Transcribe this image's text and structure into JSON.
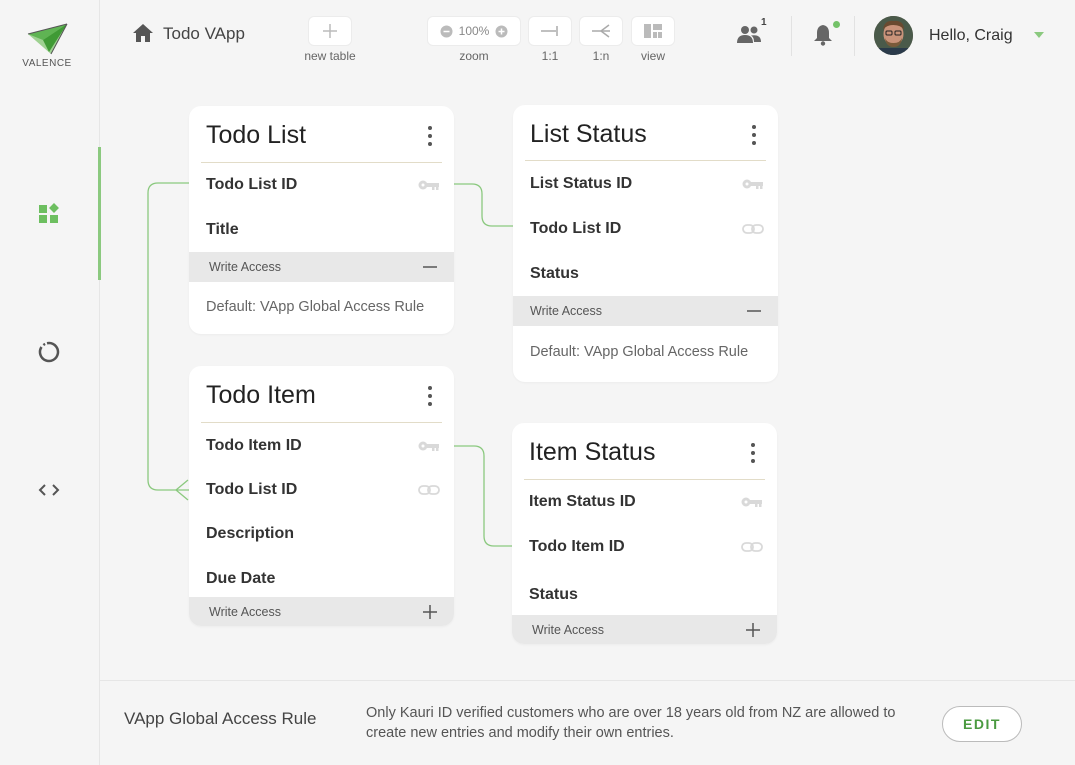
{
  "brand": {
    "name": "VALENCE",
    "accent": "#8bc97f"
  },
  "header": {
    "app_title": "Todo VApp",
    "tools": {
      "new_table": "new table",
      "zoom_label": "zoom",
      "zoom_value": "100%",
      "one_to_one": "1:1",
      "one_to_many": "1:n",
      "view": "view"
    },
    "users_count": "1",
    "greeting": "Hello, Craig"
  },
  "sidebar": {
    "items": [
      {
        "icon": "dashboard-icon",
        "active": true
      },
      {
        "icon": "sync-icon"
      },
      {
        "icon": "code-icon"
      }
    ]
  },
  "tables": {
    "todo_list": {
      "title": "Todo List",
      "fields": [
        "Todo List ID",
        "Title"
      ],
      "field_icons": [
        "key-icon",
        ""
      ],
      "access_label": "Write Access",
      "access_rule": "Default: VApp Global Access Rule"
    },
    "list_status": {
      "title": "List Status",
      "fields": [
        "List Status ID",
        "Todo List ID",
        "Status"
      ],
      "field_icons": [
        "key-icon",
        "link-icon",
        ""
      ],
      "access_label": "Write Access",
      "access_rule": "Default: VApp Global Access Rule"
    },
    "todo_item": {
      "title": "Todo Item",
      "fields": [
        "Todo Item ID",
        "Todo List ID",
        "Description",
        "Due Date"
      ],
      "field_icons": [
        "key-icon",
        "link-icon",
        "",
        ""
      ],
      "access_label": "Write Access"
    },
    "item_status": {
      "title": "Item Status",
      "fields": [
        "Item Status ID",
        "Todo Item ID",
        "Status"
      ],
      "field_icons": [
        "key-icon",
        "link-icon",
        ""
      ],
      "access_label": "Write Access"
    }
  },
  "footer": {
    "title": "VApp Global Access Rule",
    "text": "Only Kauri ID verified customers who are over 18 years old from NZ are allowed to create new entries and modify their own entries.",
    "edit_label": "EDIT"
  }
}
